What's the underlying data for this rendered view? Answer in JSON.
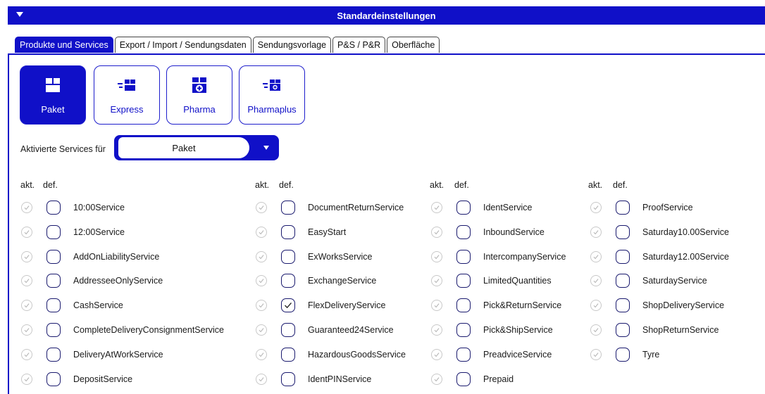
{
  "window": {
    "title": "Standardeinstellungen"
  },
  "tabs": [
    {
      "label": "Produkte und Services",
      "active": true
    },
    {
      "label": "Export / Import / Sendungsdaten",
      "active": false
    },
    {
      "label": "Sendungsvorlage",
      "active": false
    },
    {
      "label": "P&S / P&R",
      "active": false
    },
    {
      "label": "Oberfläche",
      "active": false
    }
  ],
  "products": [
    {
      "label": "Paket",
      "icon": "package-icon",
      "active": true
    },
    {
      "label": "Express",
      "icon": "express-package-icon",
      "active": false
    },
    {
      "label": "Pharma",
      "icon": "pharma-package-icon",
      "active": false
    },
    {
      "label": "Pharmaplus",
      "icon": "pharmaplus-package-icon",
      "active": false
    }
  ],
  "services_for": {
    "label": "Aktivierte Services für",
    "selected": "Paket"
  },
  "headers": {
    "akt": "akt.",
    "def": "def."
  },
  "colors": {
    "accent": "#1010c8",
    "akt_border": "#c8c8c8",
    "def_border": "#1a1a6e"
  },
  "columns": [
    {
      "services": [
        {
          "name": "10:00Service",
          "akt": true,
          "def": false
        },
        {
          "name": "12:00Service",
          "akt": true,
          "def": false
        },
        {
          "name": "AddOnLiabilityService",
          "akt": true,
          "def": false
        },
        {
          "name": "AddresseeOnlyService",
          "akt": true,
          "def": false
        },
        {
          "name": "CashService",
          "akt": true,
          "def": false
        },
        {
          "name": "CompleteDeliveryConsignmentService",
          "akt": true,
          "def": false
        },
        {
          "name": "DeliveryAtWorkService",
          "akt": true,
          "def": false
        },
        {
          "name": "DepositService",
          "akt": true,
          "def": false
        }
      ]
    },
    {
      "services": [
        {
          "name": "DocumentReturnService",
          "akt": true,
          "def": false
        },
        {
          "name": "EasyStart",
          "akt": true,
          "def": false
        },
        {
          "name": "ExWorksService",
          "akt": true,
          "def": false
        },
        {
          "name": "ExchangeService",
          "akt": true,
          "def": false
        },
        {
          "name": "FlexDeliveryService",
          "akt": true,
          "def": true
        },
        {
          "name": "Guaranteed24Service",
          "akt": true,
          "def": false
        },
        {
          "name": "HazardousGoodsService",
          "akt": true,
          "def": false
        },
        {
          "name": "IdentPINService",
          "akt": true,
          "def": false
        }
      ]
    },
    {
      "services": [
        {
          "name": "IdentService",
          "akt": true,
          "def": false
        },
        {
          "name": "InboundService",
          "akt": true,
          "def": false
        },
        {
          "name": "IntercompanyService",
          "akt": true,
          "def": false
        },
        {
          "name": "LimitedQuantities",
          "akt": true,
          "def": false
        },
        {
          "name": "Pick&ReturnService",
          "akt": true,
          "def": false
        },
        {
          "name": "Pick&ShipService",
          "akt": true,
          "def": false
        },
        {
          "name": "PreadviceService",
          "akt": true,
          "def": false
        },
        {
          "name": "Prepaid",
          "akt": true,
          "def": false
        }
      ]
    },
    {
      "services": [
        {
          "name": "ProofService",
          "akt": true,
          "def": false
        },
        {
          "name": "Saturday10.00Service",
          "akt": true,
          "def": false
        },
        {
          "name": "Saturday12.00Service",
          "akt": true,
          "def": false
        },
        {
          "name": "SaturdayService",
          "akt": true,
          "def": false
        },
        {
          "name": "ShopDeliveryService",
          "akt": true,
          "def": false
        },
        {
          "name": "ShopReturnService",
          "akt": true,
          "def": false
        },
        {
          "name": "Tyre",
          "akt": true,
          "def": false
        }
      ]
    }
  ]
}
